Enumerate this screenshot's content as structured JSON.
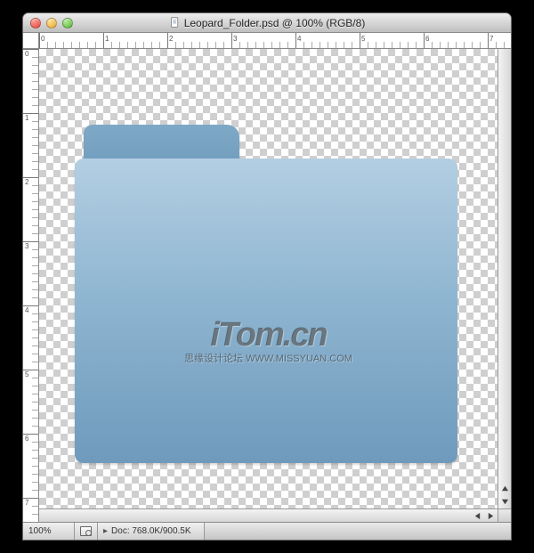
{
  "window": {
    "title": "Leopard_Folder.psd @ 100% (RGB/8)"
  },
  "status": {
    "zoom": "100%",
    "doc_label": "Doc: 768.0K/900.5K"
  },
  "watermark": {
    "logo": "iTom.cn",
    "tagline": "思缘设计论坛 WWW.MISSYUAN.COM"
  },
  "ruler": {
    "h_labels": [
      "0",
      "1",
      "2",
      "3",
      "4",
      "5",
      "6",
      "7"
    ],
    "v_labels": [
      "0",
      "1",
      "2",
      "3",
      "4",
      "5",
      "6",
      "7"
    ]
  }
}
